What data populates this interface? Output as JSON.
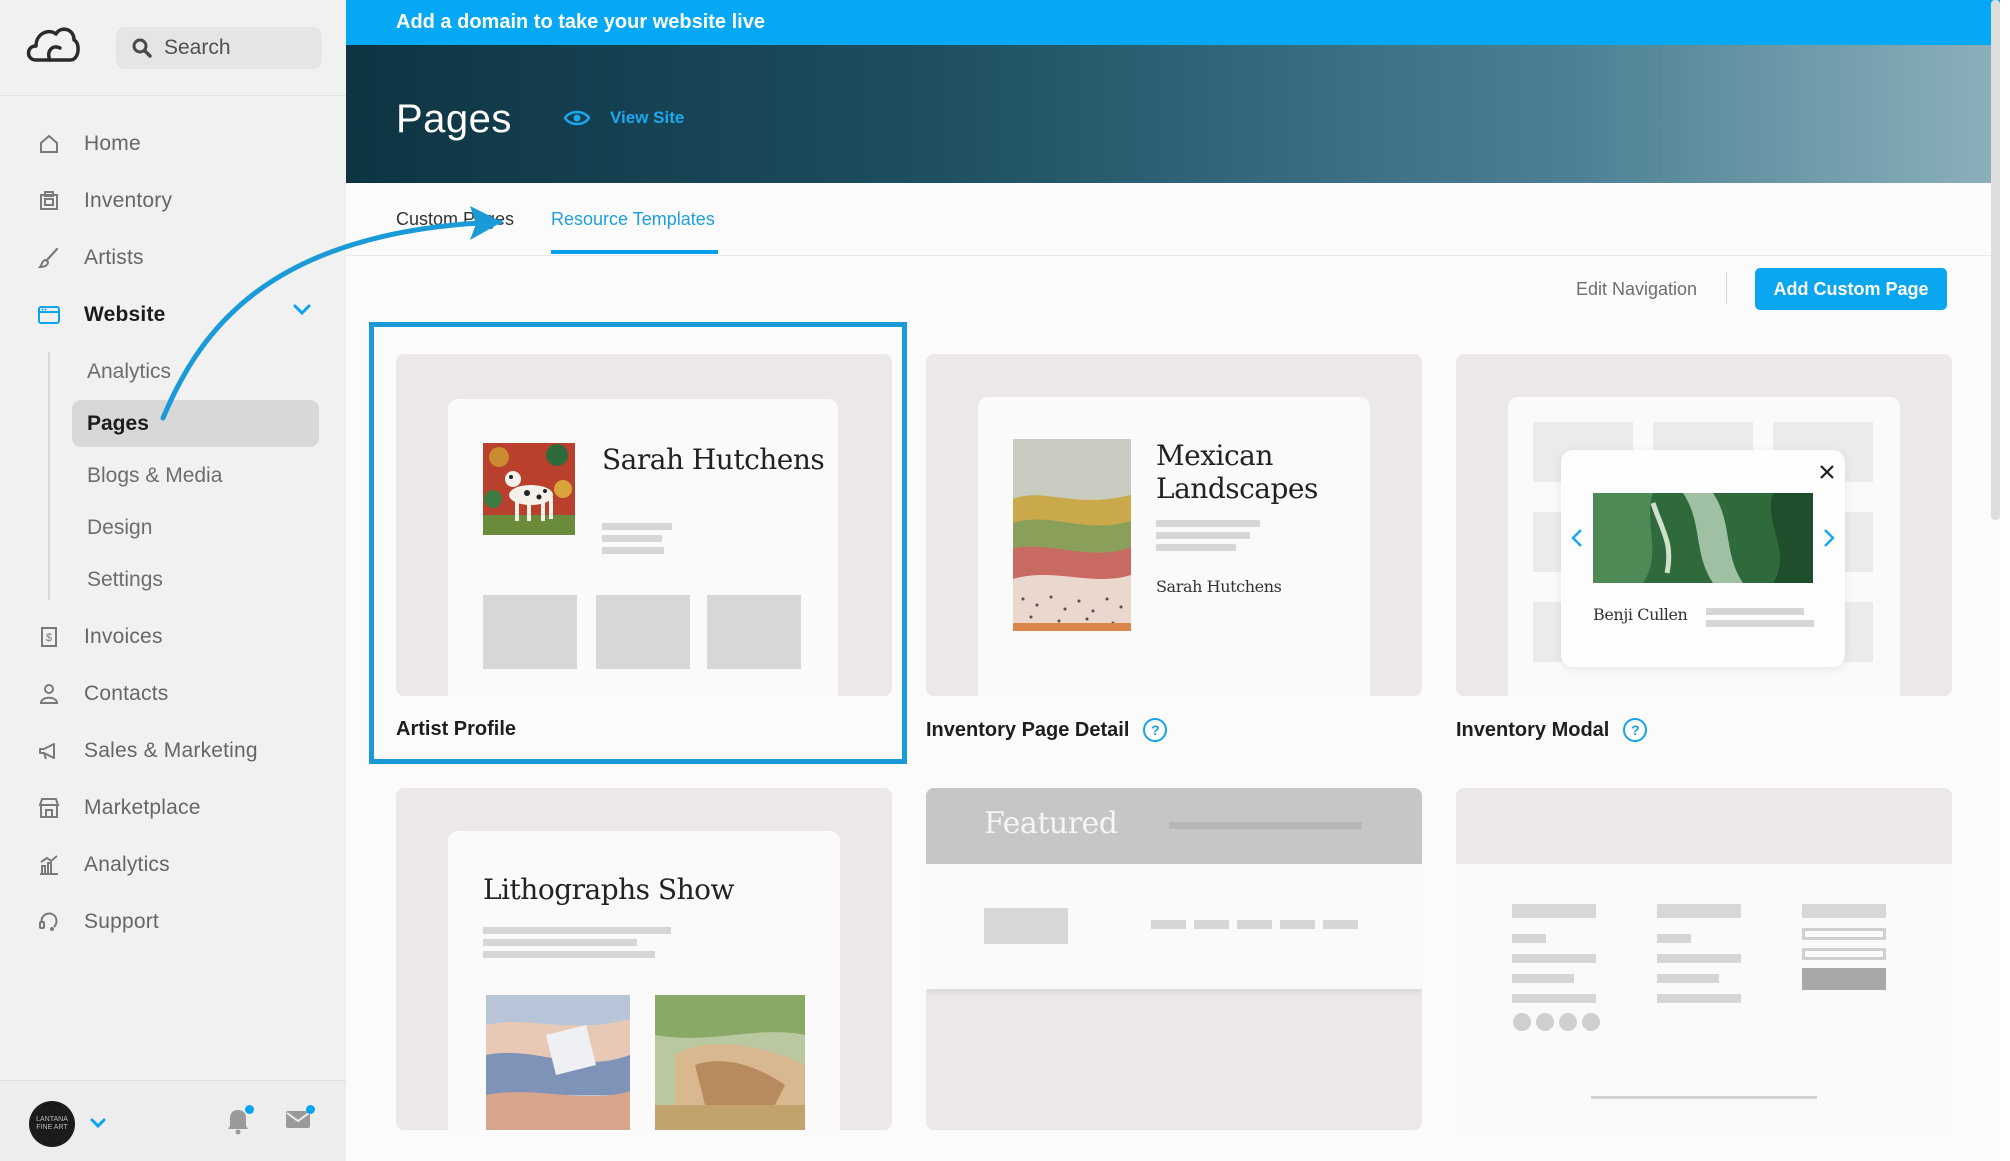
{
  "sidebar": {
    "search_placeholder": "Search",
    "nav": {
      "home": "Home",
      "inventory": "Inventory",
      "artists": "Artists",
      "website": "Website",
      "invoices": "Invoices",
      "contacts": "Contacts",
      "sales_marketing": "Sales & Marketing",
      "marketplace": "Marketplace",
      "analytics": "Analytics",
      "support": "Support"
    },
    "website_sub": {
      "analytics": "Analytics",
      "pages": "Pages",
      "blogs_media": "Blogs & Media",
      "design": "Design",
      "settings": "Settings"
    },
    "avatar_text": "LANTANA FINE ART"
  },
  "banner": {
    "text": "Add a domain to take your website live"
  },
  "hero": {
    "title": "Pages",
    "view_site": "View Site"
  },
  "tabs": {
    "custom_pages": "Custom Pages",
    "resource_templates": "Resource Templates"
  },
  "toolbar": {
    "edit_navigation": "Edit Navigation",
    "add_custom_page": "Add Custom Page"
  },
  "cards": {
    "artist_profile": {
      "label": "Artist Profile",
      "preview_title": "Sarah Hutchens"
    },
    "inventory_detail": {
      "label": "Inventory Page Detail",
      "preview_title": "Mexican Landscapes",
      "preview_artist": "Sarah Hutchens"
    },
    "inventory_modal": {
      "label": "Inventory Modal",
      "preview_artist": "Benji Cullen"
    },
    "exhibition": {
      "preview_title": "Lithographs Show"
    },
    "header": {
      "preview_title": "Featured"
    }
  },
  "colors": {
    "accent": "#05a8f4",
    "selection": "#1a9bd7",
    "sidebar_bg": "#f2f1f1"
  }
}
